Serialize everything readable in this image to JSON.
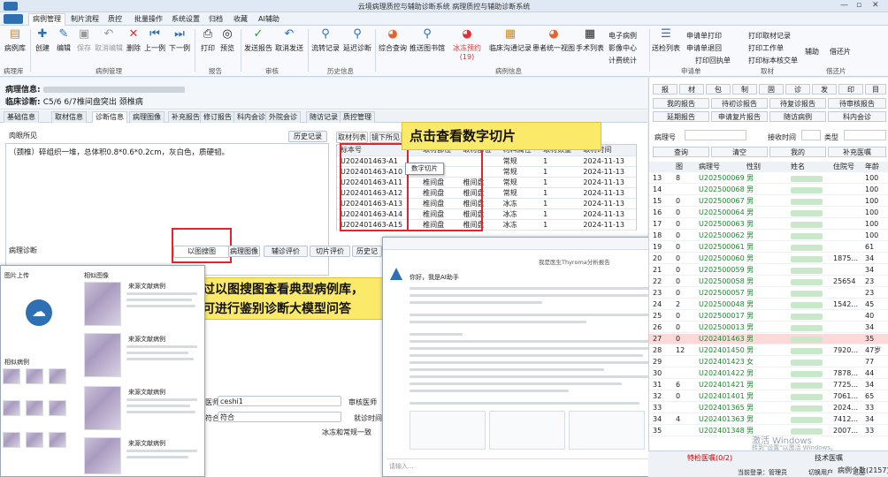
{
  "window": {
    "title": "云境病理质控与辅助诊断系统 病理质控与辅助诊断系统"
  },
  "menu": {
    "items": [
      "病例管理",
      "制片流程",
      "质控",
      "批量操作",
      "系统设置",
      "归档",
      "收藏",
      "AI辅助"
    ]
  },
  "ribbon": {
    "buttons": [
      "病例库",
      "创建",
      "编辑",
      "保存",
      "取消编辑",
      "删除",
      "上一例",
      "下一例",
      "打印",
      "预览",
      "发送报告",
      "取消发送",
      "流转记录",
      "延迟诊断",
      "综合查询",
      "推送图书馆",
      "冰冻预约(19)",
      "临床沟通记录",
      "患者统一视图",
      "手术列表",
      "电子病例",
      "影像中心",
      "计费统计",
      "送检列表"
    ],
    "small_items": [
      "申请单打印",
      "申请单退回",
      "打印回执单",
      "打印取材记录",
      "打印工作单",
      "打印标本核交单",
      "辅助",
      "借还片"
    ],
    "groups": [
      "病理库",
      "病例管理",
      "报告",
      "审核",
      "历史信息",
      "病例信息",
      "申请单",
      "取材",
      "借还片"
    ]
  },
  "patient": {
    "label1": "病理信息:",
    "label2": "临床诊断:",
    "diagnosis": "C5/6 6/7椎间盘突出 颈椎病"
  },
  "tabs": [
    "基础信息",
    "取材信息",
    "诊断信息",
    "病理图像",
    "补充报告",
    "修订报告",
    "科内会诊",
    "外院会诊",
    "随访记录",
    "质控管理"
  ],
  "gross": {
    "header": "肉眼所见",
    "history_btn": "历史记录",
    "text": "（颈椎）碎组织一堆，总体积0.8*0.6*0.2cm，灰白色，质硬韧。"
  },
  "spec_tabs": [
    "取材列表",
    "镜下所见"
  ],
  "spec_table": {
    "headers": [
      "标本号",
      "取材部位",
      "取材部位",
      "材料属性",
      "取材数量",
      "取材时间"
    ],
    "rows": [
      [
        "U202401463-A1",
        "",
        "",
        "常规",
        "1",
        "2024-11-13"
      ],
      [
        "U202401463-A10",
        "",
        "",
        "常规",
        "1",
        "2024-11-13"
      ],
      [
        "U202401463-A11",
        "椎间盘",
        "椎间盘",
        "常规",
        "1",
        "2024-11-13"
      ],
      [
        "U202401463-A12",
        "椎间盘",
        "椎间盘",
        "常规",
        "1",
        "2024-11-13"
      ],
      [
        "U202401463-A13",
        "椎间盘",
        "椎间盘",
        "冰冻",
        "1",
        "2024-11-13"
      ],
      [
        "U202401463-A14",
        "椎间盘",
        "椎间盘",
        "冰冻",
        "1",
        "2024-11-13"
      ],
      [
        "U202401463-A15",
        "椎间盘",
        "椎间盘",
        "冰冻",
        "1",
        "2024-11-13"
      ]
    ]
  },
  "context_menu": {
    "item": "数字切片"
  },
  "callout1": "点击查看数字切片",
  "callout2_l1": "通过以图搜图查看典型病例库，",
  "callout2_l2": "并可进行鉴别诊断大模型问答",
  "diag": {
    "header": "病理诊断",
    "buttons": [
      "以图搜图",
      "病理图像",
      "辅诊评价",
      "切片评价",
      "历史记"
    ]
  },
  "form": {
    "doctor_label": "医师",
    "doctor_value": "ceshi1",
    "match_label": "符合",
    "match_value": "符合",
    "review_label": "审核医师",
    "check_label": "冰冻和常规一致",
    "date_label": "就诊时间"
  },
  "search_panel": {
    "upload_title": "图片上传",
    "results_title": "相似图像",
    "upload_icon": "cloud-upload-icon",
    "label_similar": "相似病例",
    "case_name": "来源文献病例"
  },
  "chat_panel": {
    "title": "你好，我是AI助手",
    "greeting": "我是医生Thyroma分析报告",
    "input_placeholder": "请输入..."
  },
  "right": {
    "top_btns": [
      "报",
      "材",
      "包",
      "制",
      "固",
      "诊",
      "发",
      "印",
      "目"
    ],
    "row2": [
      "我的报告",
      "待初诊报告",
      "待复诊报告",
      "待审核报告"
    ],
    "row3": [
      "延期报告",
      "申请复片报告",
      "随访病例",
      "科内会诊"
    ],
    "filter_label": "病理号",
    "filter_time": "接收时间",
    "type_label": "类型",
    "actions": [
      "查询",
      "清空",
      "我的",
      "补充医嘱"
    ],
    "headers": [
      "",
      "图",
      "病理号",
      "性别",
      "姓名",
      "住院号",
      "年龄"
    ],
    "rows": [
      [
        "13",
        "8",
        "U202500069",
        "男",
        "",
        "",
        "100"
      ],
      [
        "14",
        "",
        "U202500068",
        "男",
        "",
        "",
        "100"
      ],
      [
        "15",
        "0",
        "U202500067",
        "男",
        "",
        "",
        "100"
      ],
      [
        "16",
        "0",
        "U202500064",
        "男",
        "",
        "",
        "100"
      ],
      [
        "17",
        "0",
        "U202500063",
        "男",
        "",
        "",
        "100"
      ],
      [
        "18",
        "0",
        "U202500062",
        "男",
        "",
        "",
        "100"
      ],
      [
        "19",
        "0",
        "U202500061",
        "男",
        "",
        "",
        "61"
      ],
      [
        "20",
        "0",
        "U202500060",
        "男",
        "",
        "1875...",
        "34"
      ],
      [
        "21",
        "0",
        "U202500059",
        "男",
        "",
        "",
        "34"
      ],
      [
        "22",
        "0",
        "U202500058",
        "男",
        "",
        "25654",
        "23"
      ],
      [
        "23",
        "0",
        "U202500057",
        "男",
        "",
        "",
        "23"
      ],
      [
        "24",
        "2",
        "U202500048",
        "男",
        "",
        "1542...",
        "45"
      ],
      [
        "25",
        "0",
        "U202500017",
        "男",
        "",
        "",
        "40"
      ],
      [
        "26",
        "0",
        "U202500013",
        "男",
        "",
        "",
        "34"
      ],
      [
        "27",
        "0",
        "U202401463",
        "男",
        "",
        "",
        "35"
      ],
      [
        "28",
        "12",
        "U202401450",
        "男",
        "",
        "7920...",
        "47岁"
      ],
      [
        "29",
        "",
        "U202401423",
        "女",
        "",
        "",
        "77"
      ],
      [
        "30",
        "",
        "U202401422",
        "男",
        "",
        "7878...",
        "44"
      ],
      [
        "31",
        "6",
        "U202401421",
        "男",
        "",
        "7725...",
        "34"
      ],
      [
        "32",
        "0",
        "U202401401",
        "男",
        "",
        "7061...",
        "65"
      ],
      [
        "33",
        "",
        "U202401365",
        "男",
        "",
        "2024...",
        "33"
      ],
      [
        "34",
        "4",
        "U202401363",
        "男",
        "",
        "7412...",
        "34"
      ],
      [
        "35",
        "",
        "U202401348",
        "男",
        "",
        "2007...",
        "33"
      ]
    ],
    "status_tab1": "特检医嘱(0/2)",
    "status_tab2": "技术医嘱",
    "count": "病例个数(2157)",
    "user_label": "当前登录：管理员",
    "switch_user": "切换用户",
    "exit": "退出"
  },
  "watermark": {
    "l1": "激活 Windows",
    "l2": "转到\"设置\"以激活 Windows。"
  },
  "colors": {
    "highlight": "#fbe96a",
    "red": "#e0262b",
    "accent": "#2f6fb3"
  }
}
